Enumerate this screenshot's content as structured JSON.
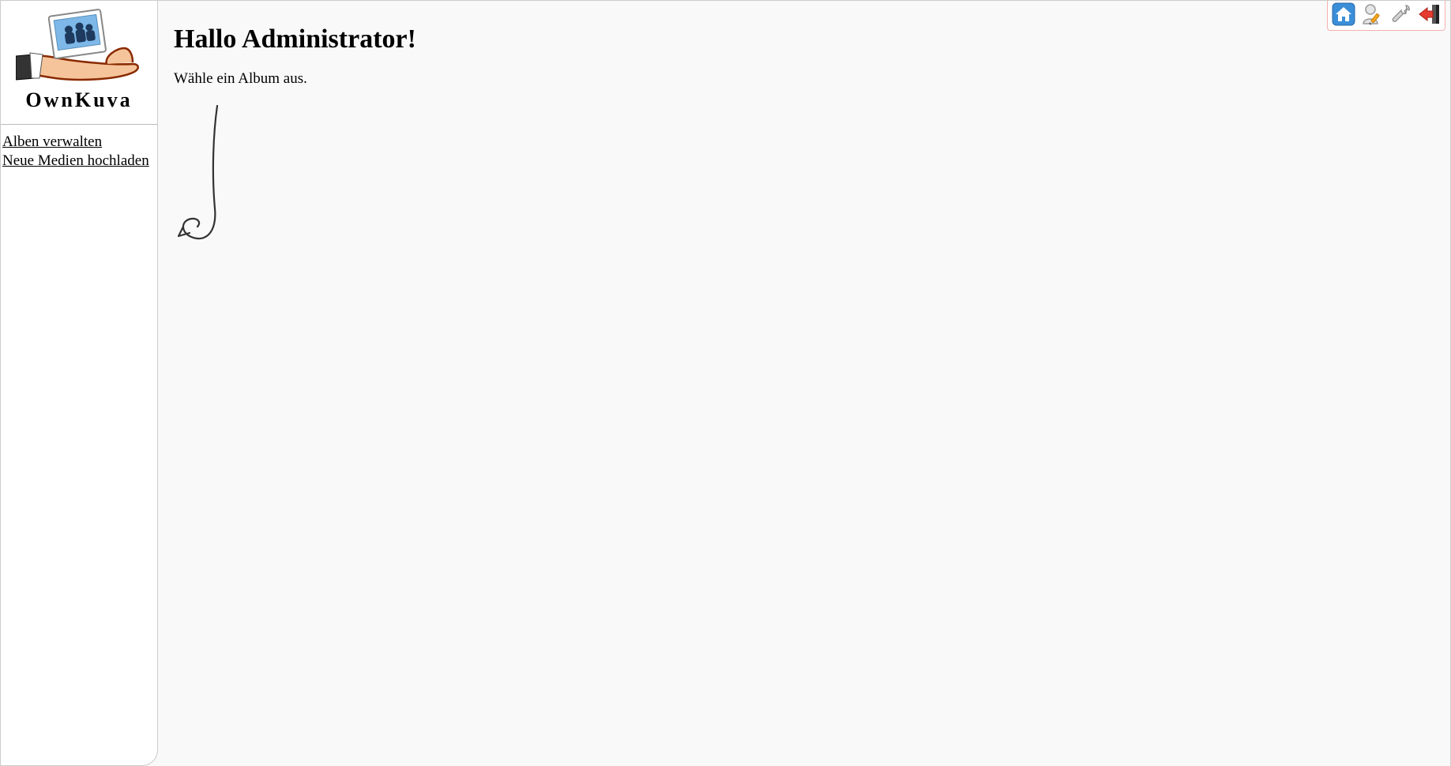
{
  "app": {
    "name": "OwnKuva"
  },
  "sidebar": {
    "links": [
      {
        "label": "Alben verwalten"
      },
      {
        "label": "Neue Medien hochladen"
      }
    ]
  },
  "main": {
    "heading": "Hallo Administrator!",
    "instruction": "Wähle ein Album aus."
  },
  "toolbar": {
    "home": "home-icon",
    "user": "user-edit-icon",
    "settings": "wrench-icon",
    "logout": "logout-icon"
  }
}
